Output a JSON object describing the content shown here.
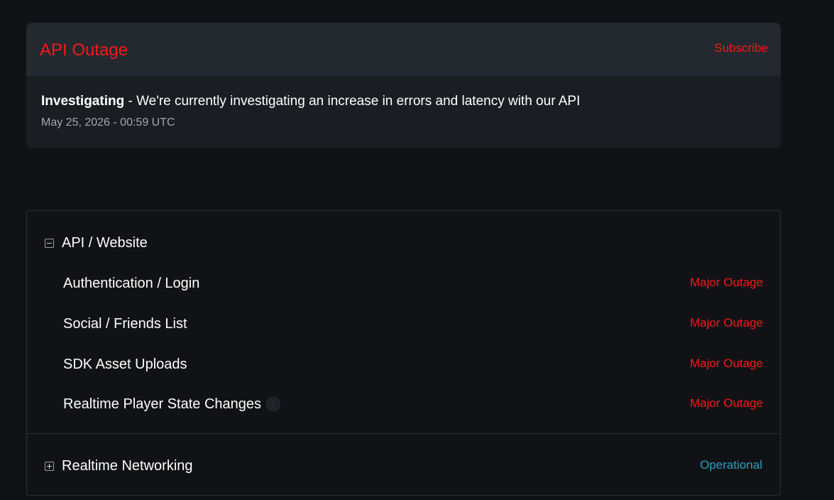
{
  "incident": {
    "title": "API Outage",
    "subscribe_label": "Subscribe",
    "update_status": "Investigating",
    "update_message": " - We're currently investigating an increase in errors and latency with our API",
    "update_time": "May 25, 2026 - 00:59 UTC"
  },
  "groups": [
    {
      "name": "API / Website",
      "expanded": true,
      "components": [
        {
          "name": "Authentication / Login",
          "status": "Major Outage"
        },
        {
          "name": "Social / Friends List",
          "status": "Major Outage"
        },
        {
          "name": "SDK Asset Uploads",
          "status": "Major Outage"
        },
        {
          "name": "Realtime Player State Changes",
          "status": "Major Outage",
          "help_icon": "question-mark-icon"
        }
      ]
    },
    {
      "name": "Realtime Networking",
      "expanded": false,
      "status": "Operational"
    }
  ],
  "colors": {
    "outage": "#f41a1a",
    "operational": "#2a9fc0",
    "background": "#111215"
  }
}
